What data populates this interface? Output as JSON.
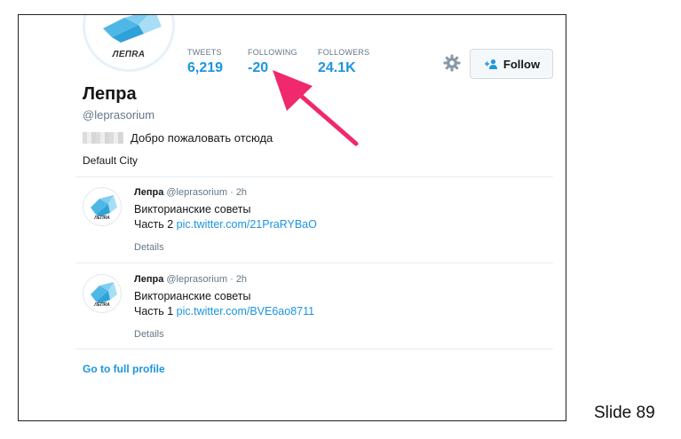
{
  "profile": {
    "brand_text": "ЛЕПRA",
    "name": "Лепра",
    "handle": "@leprasorium",
    "bio": "Добро пожаловать отсюда",
    "location": "Default City"
  },
  "stats": [
    {
      "label": "TWEETS",
      "value": "6,219"
    },
    {
      "label": "FOLLOWING",
      "value": "-20"
    },
    {
      "label": "FOLLOWERS",
      "value": "24.1K"
    }
  ],
  "actions": {
    "follow_label": "Follow"
  },
  "tweets": [
    {
      "author": "Лепра",
      "handle": "@leprasorium",
      "time": "· 2h",
      "line1": "Викторианские советы",
      "line2_prefix": "Часть 2 ",
      "link": "pic.twitter.com/21PraRYBaO",
      "details": "Details",
      "brand_text": "ЛЕПRA"
    },
    {
      "author": "Лепра",
      "handle": "@leprasorium",
      "time": "· 2h",
      "line1": "Викторианские советы",
      "line2_prefix": "Часть 1 ",
      "link": "pic.twitter.com/BVE6ao8711",
      "details": "Details",
      "brand_text": "ЛЕПRA"
    }
  ],
  "footer": {
    "full_profile_link": "Go to full profile"
  },
  "slide": {
    "label": "Slide 89"
  },
  "colors": {
    "link_blue": "#1b95e0",
    "arrow_pink": "#f0286e",
    "muted_gray": "#657786"
  }
}
